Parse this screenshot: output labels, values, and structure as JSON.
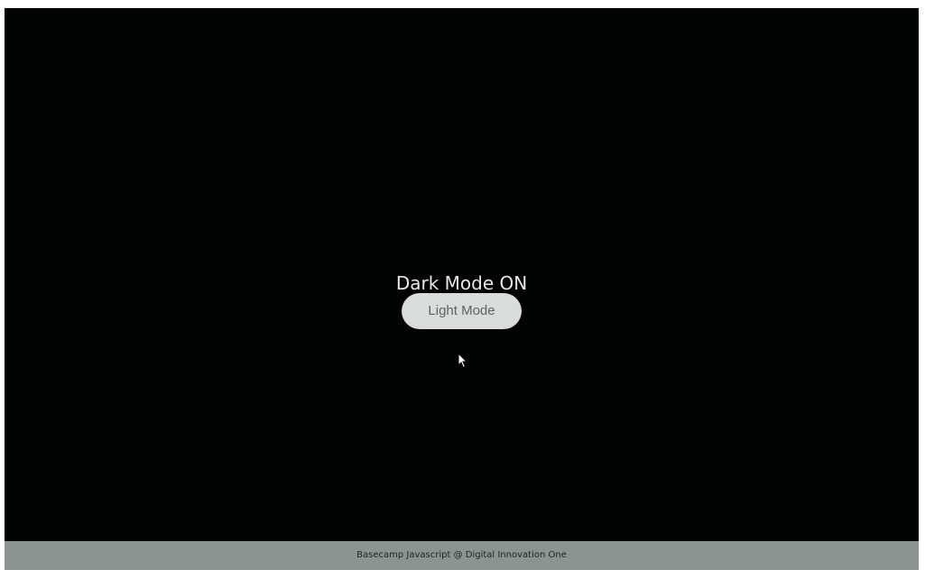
{
  "main": {
    "title": "Dark Mode ON",
    "toggle_button_label": "Light Mode"
  },
  "footer": {
    "text": "Basecamp Javascript @ Digital Innovation One"
  },
  "icons": {
    "cursor": "mouse-pointer-icon"
  },
  "colors": {
    "background": "#010302",
    "title_text": "#e8e8e8",
    "button_bg": "#d9dcdb",
    "button_text": "#5f6462",
    "footer_bg": "#8c9390",
    "footer_text": "#222524"
  }
}
